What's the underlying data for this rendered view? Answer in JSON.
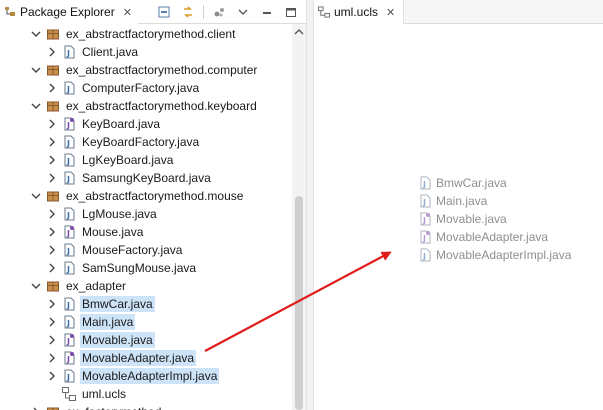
{
  "left_view": {
    "tab_label": "Package Explorer",
    "tab_close": "✕"
  },
  "tree": {
    "rows": [
      {
        "label": "ex_abstractfactorymethod.client",
        "kind": "package",
        "expanded": true
      },
      {
        "label": "Client.java",
        "kind": "class"
      },
      {
        "label": "ex_abstractfactorymethod.computer",
        "kind": "package",
        "expanded": true
      },
      {
        "label": "ComputerFactory.java",
        "kind": "class"
      },
      {
        "label": "ex_abstractfactorymethod.keyboard",
        "kind": "package",
        "expanded": true
      },
      {
        "label": "KeyBoard.java",
        "kind": "interface"
      },
      {
        "label": "KeyBoardFactory.java",
        "kind": "class"
      },
      {
        "label": "LgKeyBoard.java",
        "kind": "class"
      },
      {
        "label": "SamsungKeyBoard.java",
        "kind": "class"
      },
      {
        "label": "ex_abstractfactorymethod.mouse",
        "kind": "package",
        "expanded": true
      },
      {
        "label": "LgMouse.java",
        "kind": "class"
      },
      {
        "label": "Mouse.java",
        "kind": "interface"
      },
      {
        "label": "MouseFactory.java",
        "kind": "class"
      },
      {
        "label": "SamSungMouse.java",
        "kind": "class"
      },
      {
        "label": "ex_adapter",
        "kind": "package",
        "expanded": true
      },
      {
        "label": "BmwCar.java",
        "kind": "class",
        "selected": true
      },
      {
        "label": "Main.java",
        "kind": "class",
        "selected": true
      },
      {
        "label": "Movable.java",
        "kind": "interface",
        "selected": true
      },
      {
        "label": "MovableAdapter.java",
        "kind": "interface",
        "selected": true
      },
      {
        "label": "MovableAdapterImpl.java",
        "kind": "class",
        "selected": true
      },
      {
        "label": "uml.ucls",
        "kind": "ucls"
      },
      {
        "label": "ex_factorymethod",
        "kind": "package",
        "expanded": false
      }
    ]
  },
  "editor": {
    "tab_label": "uml.ucls",
    "tab_close": "✕",
    "drag_items": [
      {
        "label": "BmwCar.java",
        "kind": "class"
      },
      {
        "label": "Main.java",
        "kind": "class"
      },
      {
        "label": "Movable.java",
        "kind": "interface"
      },
      {
        "label": "MovableAdapter.java",
        "kind": "interface"
      },
      {
        "label": "MovableAdapterImpl.java",
        "kind": "class"
      }
    ]
  },
  "colors": {
    "selection": "#cde3f7",
    "package_brown": "#a0693a",
    "java_blue": "#3c6ea8",
    "interface_purple": "#7b4cb0",
    "arrow_red": "#e11a1a"
  }
}
